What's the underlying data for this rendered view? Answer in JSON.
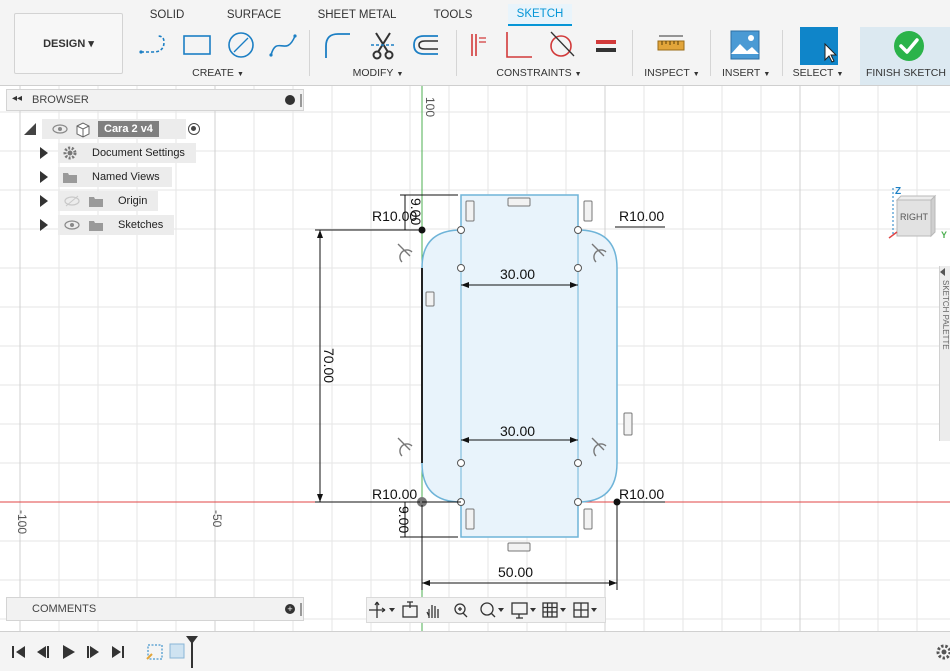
{
  "design_button": "DESIGN ▾",
  "tabs": [
    "SOLID",
    "SURFACE",
    "SHEET METAL",
    "TOOLS",
    "SKETCH"
  ],
  "panels": {
    "create": "CREATE",
    "modify": "MODIFY",
    "constraints": "CONSTRAINTS",
    "inspect": "INSPECT",
    "insert": "INSERT",
    "select": "SELECT",
    "finish": "FINISH SKETCH"
  },
  "browser": {
    "title": "BROWSER",
    "root": "Cara 2 v4",
    "items": [
      "Document Settings",
      "Named Views",
      "Origin",
      "Sketches"
    ]
  },
  "comments_title": "COMMENTS",
  "viewcube_label": "RIGHT",
  "viewcube_axes": {
    "z": "Z",
    "y": "Y"
  },
  "side_palette_label": "SKETCH PALETTE",
  "axis_ticks": {
    "top": "100",
    "left_far": "-100",
    "left_mid": "-50"
  },
  "dimensions": {
    "radius_tl": "R10.00",
    "radius_tr": "R10.00",
    "radius_bl": "R10.00",
    "radius_br": "R10.00",
    "tab_top": "9.00",
    "tab_bottom": "9.00",
    "height": "70.00",
    "inner_top": "30.00",
    "inner_bottom": "30.00",
    "width": "50.00",
    "left_mark": "50"
  },
  "colors": {
    "accent": "#0696d7",
    "finish_green": "#2bb34a",
    "sketch_fill": "#e8f3fb",
    "sketch_line": "#6fb4d8",
    "axis_red": "#e04545",
    "axis_green": "#4caf50"
  }
}
